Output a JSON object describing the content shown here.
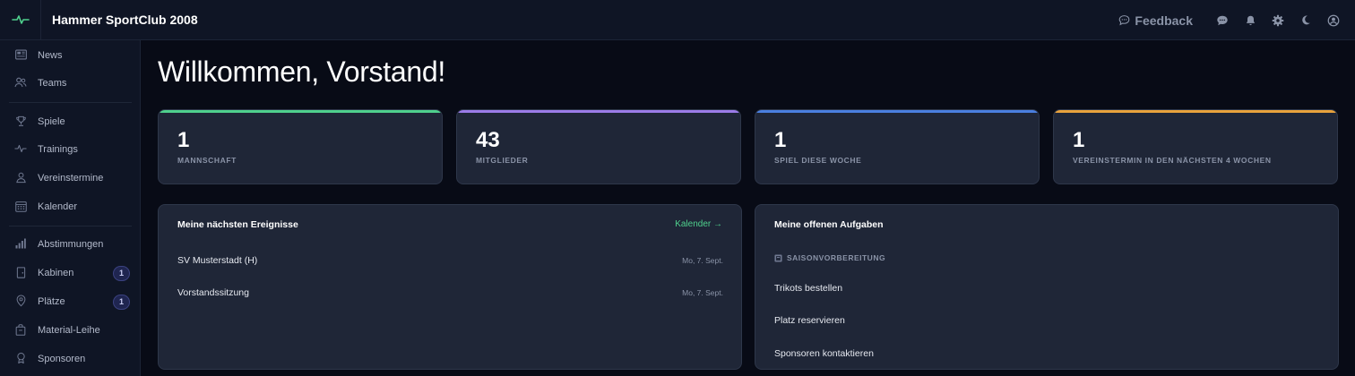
{
  "app": {
    "title": "Hammer SportClub 2008"
  },
  "topbar": {
    "feedback_label": "Feedback"
  },
  "sidebar": {
    "items": [
      {
        "label": "News"
      },
      {
        "label": "Teams"
      },
      {
        "label": "Spiele"
      },
      {
        "label": "Trainings"
      },
      {
        "label": "Vereinstermine"
      },
      {
        "label": "Kalender"
      },
      {
        "label": "Abstimmungen"
      },
      {
        "label": "Kabinen",
        "badge": "1"
      },
      {
        "label": "Plätze",
        "badge": "1"
      },
      {
        "label": "Material-Leihe"
      },
      {
        "label": "Sponsoren"
      }
    ]
  },
  "main": {
    "welcome": "Willkommen, Vorstand!",
    "stats": [
      {
        "value": "1",
        "label": "MANNSCHAFT",
        "color": "#4fd08d"
      },
      {
        "value": "43",
        "label": "MITGLIEDER",
        "color": "#9b7be8"
      },
      {
        "value": "1",
        "label": "SPIEL DIESE WOCHE",
        "color": "#4a7fe0"
      },
      {
        "value": "1",
        "label": "VEREINSTERMIN IN DEN NÄCHSTEN 4 WOCHEN",
        "color": "#e8a23c"
      }
    ],
    "events_panel": {
      "title": "Meine nächsten Ereignisse",
      "link": "Kalender →",
      "events": [
        {
          "name": "SV Musterstadt (H)",
          "date": "Mo, 7. Sept."
        },
        {
          "name": "Vorstandssitzung",
          "date": "Mo, 7. Sept."
        }
      ]
    },
    "tasks_panel": {
      "title": "Meine offenen Aufgaben",
      "group": "SAISONVORBEREITUNG",
      "tasks": [
        {
          "name": "Trikots bestellen"
        },
        {
          "name": "Platz reservieren"
        },
        {
          "name": "Sponsoren kontaktieren"
        }
      ]
    }
  },
  "colors": {
    "accent": "#4fd08d",
    "background": "#080b16",
    "surface": "#1f2637"
  }
}
